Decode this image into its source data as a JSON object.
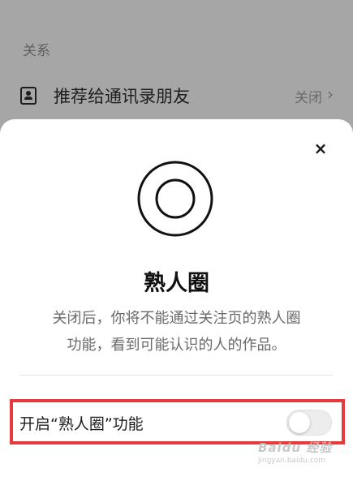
{
  "background": {
    "section_label": "关系",
    "row": {
      "icon": "contact-card-icon",
      "title": "推荐给通讯录朋友",
      "value": "关闭",
      "chevron": "›"
    }
  },
  "sheet": {
    "close_icon": "×",
    "ring_icon": "concentric-circles-icon",
    "title": "熟人圈",
    "description_line1": "关闭后，你将不能通过关注页的熟人圈",
    "description_line2": "功能，看到可能认识的人的作品。",
    "toggle": {
      "label": "开启“熟人圈”功能",
      "state": "off"
    }
  },
  "highlight_color": "#e83a3a",
  "watermark": {
    "main": "Baidu 经验",
    "sub": "jingyan.baidu.com"
  }
}
